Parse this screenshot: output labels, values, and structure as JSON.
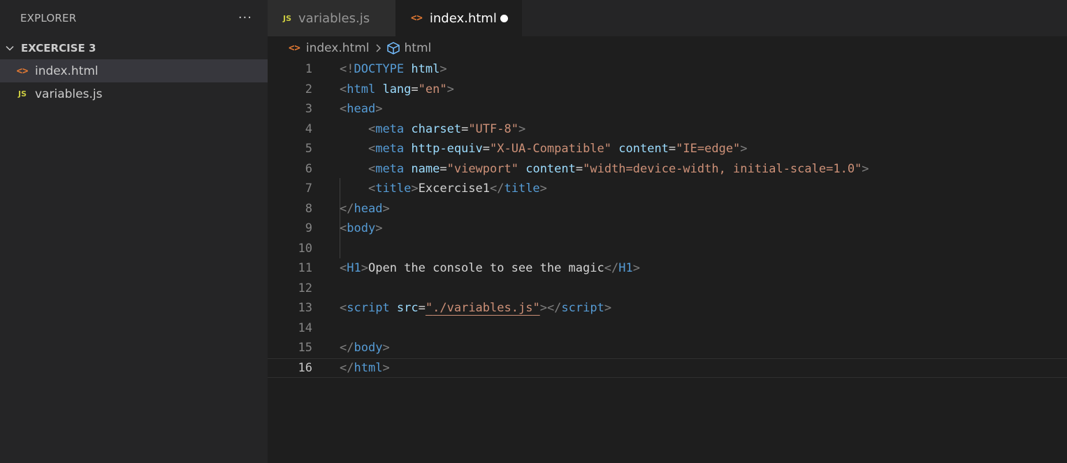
{
  "sidebar": {
    "title": "EXPLORER",
    "more_icon": "···",
    "folder": "EXCERCISE 3",
    "files": [
      {
        "name": "index.html",
        "icon": "<>"
      },
      {
        "name": "variables.js",
        "icon": "JS"
      }
    ]
  },
  "tabs": [
    {
      "label": "variables.js",
      "icon": "JS"
    },
    {
      "label": "index.html",
      "icon": "<>"
    }
  ],
  "breadcrumb": {
    "file": "index.html",
    "symbol": "html"
  },
  "code": {
    "line_numbers": [
      "1",
      "2",
      "3",
      "4",
      "5",
      "6",
      "7",
      "8",
      "9",
      "10",
      "11",
      "12",
      "13",
      "14",
      "15",
      "16"
    ],
    "l1": {
      "open": "<!",
      "doctype": "DOCTYPE",
      "html": "html",
      "close": ">"
    },
    "l2": {
      "open": "<",
      "tag": "html",
      "attr": "lang",
      "eq": "=",
      "val": "\"en\"",
      "close": ">"
    },
    "l3": {
      "open": "<",
      "tag": "head",
      "close": ">"
    },
    "l4": {
      "indent": "    ",
      "open": "<",
      "tag": "meta",
      "attr": "charset",
      "eq": "=",
      "val": "\"UTF-8\"",
      "close": ">"
    },
    "l5": {
      "indent": "    ",
      "open": "<",
      "tag": "meta",
      "attr1": "http-equiv",
      "eq": "=",
      "val1": "\"X-UA-Compatible\"",
      "attr2": "content",
      "val2": "\"IE=edge\"",
      "close": ">"
    },
    "l6": {
      "indent": "    ",
      "open": "<",
      "tag": "meta",
      "attr1": "name",
      "eq": "=",
      "val1": "\"viewport\"",
      "attr2": "content",
      "val2": "\"width=device-width, initial-scale=1.0\"",
      "close": ">"
    },
    "l7": {
      "indent": "    ",
      "open": "<",
      "tag": "title",
      "close": ">",
      "text": "Excercise1",
      "endopen": "</"
    },
    "l8": {
      "open": "</",
      "tag": "head",
      "close": ">"
    },
    "l9": {
      "open": "<",
      "tag": "body",
      "close": ">"
    },
    "l11": {
      "open": "<",
      "tag": "H1",
      "close": ">",
      "text": "Open the console to see the magic",
      "endopen": "</"
    },
    "l13": {
      "open": "<",
      "tag": "script",
      "attr": "src",
      "eq": "=",
      "q": "\"",
      "link": "./variables.js",
      "close": ">",
      "endopen": "</"
    },
    "l15": {
      "open": "</",
      "tag": "body",
      "close": ">"
    },
    "l16": {
      "open": "</",
      "tag": "html",
      "close": ">"
    }
  },
  "colors": {
    "tag": "#569cd6",
    "attribute": "#9cdcfe",
    "string": "#ce9178",
    "punctuation": "#808080",
    "js_icon": "#cbcb41",
    "html_icon": "#e37933"
  }
}
